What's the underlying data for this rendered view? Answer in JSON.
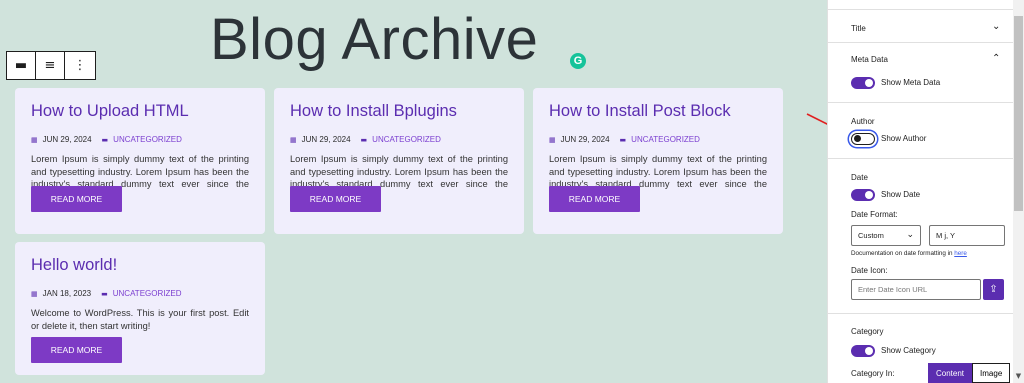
{
  "page_title": "Blog Archive",
  "grammarly_label": "G",
  "toolbar": {
    "buttons": [
      "▬",
      "≡",
      "⋮"
    ]
  },
  "posts": [
    {
      "title": "How to Upload HTML",
      "date": "JUN 29, 2024",
      "category": "UNCATEGORIZED",
      "excerpt": "Lorem Ipsum is simply dummy text of the printing and typesetting industry. Lorem Ipsum has been the industry's standard dummy text ever since the 1500s,",
      "button": "READ MORE"
    },
    {
      "title": "How to Install Bplugins",
      "date": "JUN 29, 2024",
      "category": "UNCATEGORIZED",
      "excerpt": "Lorem Ipsum is simply dummy text of the printing and typesetting industry. Lorem Ipsum has been the industry's standard dummy text ever since the 1500s,",
      "button": "READ MORE"
    },
    {
      "title": "How to Install Post Block",
      "date": "JUN 29, 2024",
      "category": "UNCATEGORIZED",
      "excerpt": "Lorem Ipsum is simply dummy text of the printing and typesetting industry. Lorem Ipsum has been the industry's standard dummy text ever since the 1500s,",
      "button": "READ MORE"
    },
    {
      "title": "Hello world!",
      "date": "JAN 18, 2023",
      "category": "UNCATEGORIZED",
      "excerpt": "Welcome to WordPress. This is your first post. Edit or delete it, then start writing!",
      "button": "READ MORE"
    }
  ],
  "sidebar": {
    "title_section": "Title",
    "meta_section": "Meta Data",
    "show_meta": "Show Meta Data",
    "author_heading": "Author",
    "show_author": "Show Author",
    "date_heading": "Date",
    "show_date": "Show Date",
    "date_format_label": "Date Format:",
    "date_format_select": "Custom",
    "date_format_value": "M j, Y",
    "doc_text": "Documentation on date formatting in ",
    "doc_link": "here",
    "date_icon_label": "Date Icon:",
    "date_icon_placeholder": "Enter Date Icon URL",
    "category_heading": "Category",
    "show_category": "Show Category",
    "category_in_label": "Category In:",
    "category_options": [
      "Content",
      "Image"
    ]
  },
  "colors": {
    "accent": "#5b2db0",
    "button": "#7d3ac5",
    "card_bg": "#f0eefc",
    "canvas_bg": "#d0e3dc"
  }
}
